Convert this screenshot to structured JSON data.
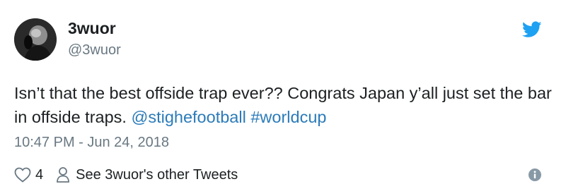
{
  "author": {
    "display_name": "3wuor",
    "handle": "@3wuor",
    "avatar_icon": "profile-photo"
  },
  "tweet": {
    "text_before": "Isn’t that the best offside trap ever?? Congrats Japan y’all just set the bar in offside traps. ",
    "mention": "@stighefootball",
    "hashtag": "#worldcup",
    "timestamp": "10:47 PM - Jun 24, 2018"
  },
  "actions": {
    "like_icon": "heart-icon",
    "like_count": "4",
    "profile_icon": "person-icon",
    "profile_link": "See 3wuor's other Tweets",
    "info_icon": "info-icon"
  },
  "colors": {
    "brand": "#1da1f2",
    "link": "#2b7bb9",
    "secondary_text": "#697882",
    "primary_text": "#1c2022"
  }
}
